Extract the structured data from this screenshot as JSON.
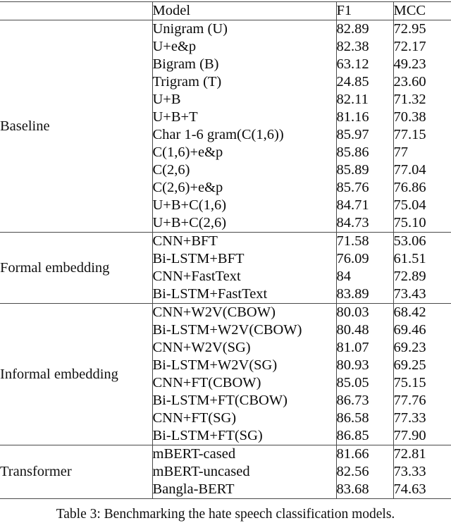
{
  "table": {
    "columns": [
      "",
      "Model",
      "F1",
      "MCC"
    ],
    "header": {
      "group_label": "",
      "model": "Model",
      "f1": "F1",
      "mcc": "MCC"
    },
    "sections": [
      {
        "group": "Baseline",
        "rows": [
          {
            "model": "Unigram (U)",
            "f1": "82.89",
            "mcc": "72.95",
            "model_bold": false,
            "f1_bold": false,
            "mcc_bold": false
          },
          {
            "model": "U+e&p",
            "f1": "82.38",
            "mcc": "72.17",
            "model_bold": false,
            "f1_bold": false,
            "mcc_bold": false
          },
          {
            "model": "Bigram (B)",
            "f1": "63.12",
            "mcc": "49.23",
            "model_bold": false,
            "f1_bold": false,
            "mcc_bold": false
          },
          {
            "model": "Trigram (T)",
            "f1": "24.85",
            "mcc": "23.60",
            "model_bold": false,
            "f1_bold": false,
            "mcc_bold": false
          },
          {
            "model": "U+B",
            "f1": "82.11",
            "mcc": "71.32",
            "model_bold": false,
            "f1_bold": false,
            "mcc_bold": false
          },
          {
            "model": "U+B+T",
            "f1": "81.16",
            "mcc": "70.38",
            "model_bold": false,
            "f1_bold": false,
            "mcc_bold": false
          },
          {
            "model": "Char 1-6 gram(C(1,6))",
            "f1": "85.97",
            "mcc": "77.15",
            "model_bold": false,
            "f1_bold": true,
            "mcc_bold": false
          },
          {
            "model": "C(1,6)+e&p",
            "f1": "85.86",
            "mcc": "77",
            "model_bold": false,
            "f1_bold": false,
            "mcc_bold": false
          },
          {
            "model": "C(2,6)",
            "f1": "85.89",
            "mcc": "77.04",
            "model_bold": false,
            "f1_bold": false,
            "mcc_bold": false
          },
          {
            "model": "C(2,6)+e&p",
            "f1": "85.76",
            "mcc": "76.86",
            "model_bold": false,
            "f1_bold": false,
            "mcc_bold": false
          },
          {
            "model": "U+B+C(1,6)",
            "f1": "84.71",
            "mcc": "75.04",
            "model_bold": false,
            "f1_bold": false,
            "mcc_bold": false
          },
          {
            "model": "U+B+C(2,6)",
            "f1": "84.73",
            "mcc": "75.10",
            "model_bold": false,
            "f1_bold": false,
            "mcc_bold": false
          }
        ]
      },
      {
        "group": "Formal embedding",
        "rows": [
          {
            "model": "CNN+BFT",
            "f1": "71.58",
            "mcc": "53.06",
            "model_bold": false,
            "f1_bold": false,
            "mcc_bold": false
          },
          {
            "model": "Bi-LSTM+BFT",
            "f1": "76.09",
            "mcc": "61.51",
            "model_bold": false,
            "f1_bold": false,
            "mcc_bold": false
          },
          {
            "model": "CNN+FastText",
            "f1": "84",
            "mcc": "72.89",
            "model_bold": false,
            "f1_bold": false,
            "mcc_bold": false
          },
          {
            "model": "Bi-LSTM+FastText",
            "f1": "83.89",
            "mcc": "73.43",
            "model_bold": false,
            "f1_bold": false,
            "mcc_bold": false
          }
        ]
      },
      {
        "group": "Informal embedding",
        "rows": [
          {
            "model": "CNN+W2V(CBOW)",
            "f1": "80.03",
            "mcc": "68.42",
            "model_bold": false,
            "f1_bold": false,
            "mcc_bold": false
          },
          {
            "model": "Bi-LSTM+W2V(CBOW)",
            "f1": "80.48",
            "mcc": "69.46",
            "model_bold": false,
            "f1_bold": false,
            "mcc_bold": false
          },
          {
            "model": "CNN+W2V(SG)",
            "f1": "81.07",
            "mcc": "69.23",
            "model_bold": false,
            "f1_bold": false,
            "mcc_bold": false
          },
          {
            "model": "Bi-LSTM+W2V(SG)",
            "f1": "80.93",
            "mcc": "69.25",
            "model_bold": false,
            "f1_bold": false,
            "mcc_bold": false
          },
          {
            "model": "CNN+FT(CBOW)",
            "f1": "85.05",
            "mcc": "75.15",
            "model_bold": false,
            "f1_bold": false,
            "mcc_bold": false
          },
          {
            "model": "Bi-LSTM+FT(CBOW)",
            "f1": "86.73",
            "mcc": "77.76",
            "model_bold": false,
            "f1_bold": false,
            "mcc_bold": false
          },
          {
            "model": "CNN+FT(SG)",
            "f1": "86.58",
            "mcc": "77.33",
            "model_bold": false,
            "f1_bold": false,
            "mcc_bold": false
          },
          {
            "model": "Bi-LSTM+FT(SG)",
            "f1": "86.85",
            "mcc": "77.90",
            "model_bold": true,
            "f1_bold": true,
            "mcc_bold": true
          }
        ]
      },
      {
        "group": "Transformer",
        "rows": [
          {
            "model": "mBERT-cased",
            "f1": "81.66",
            "mcc": "72.81",
            "model_bold": false,
            "f1_bold": false,
            "mcc_bold": false
          },
          {
            "model": "mBERT-uncased",
            "f1": "82.56",
            "mcc": "73.33",
            "model_bold": false,
            "f1_bold": false,
            "mcc_bold": false
          },
          {
            "model": "Bangla-BERT",
            "f1": "83.68",
            "mcc": "74.63",
            "model_bold": false,
            "f1_bold": false,
            "mcc_bold": false
          }
        ]
      }
    ]
  },
  "caption": "Table 3: Benchmarking the hate speech classification models."
}
